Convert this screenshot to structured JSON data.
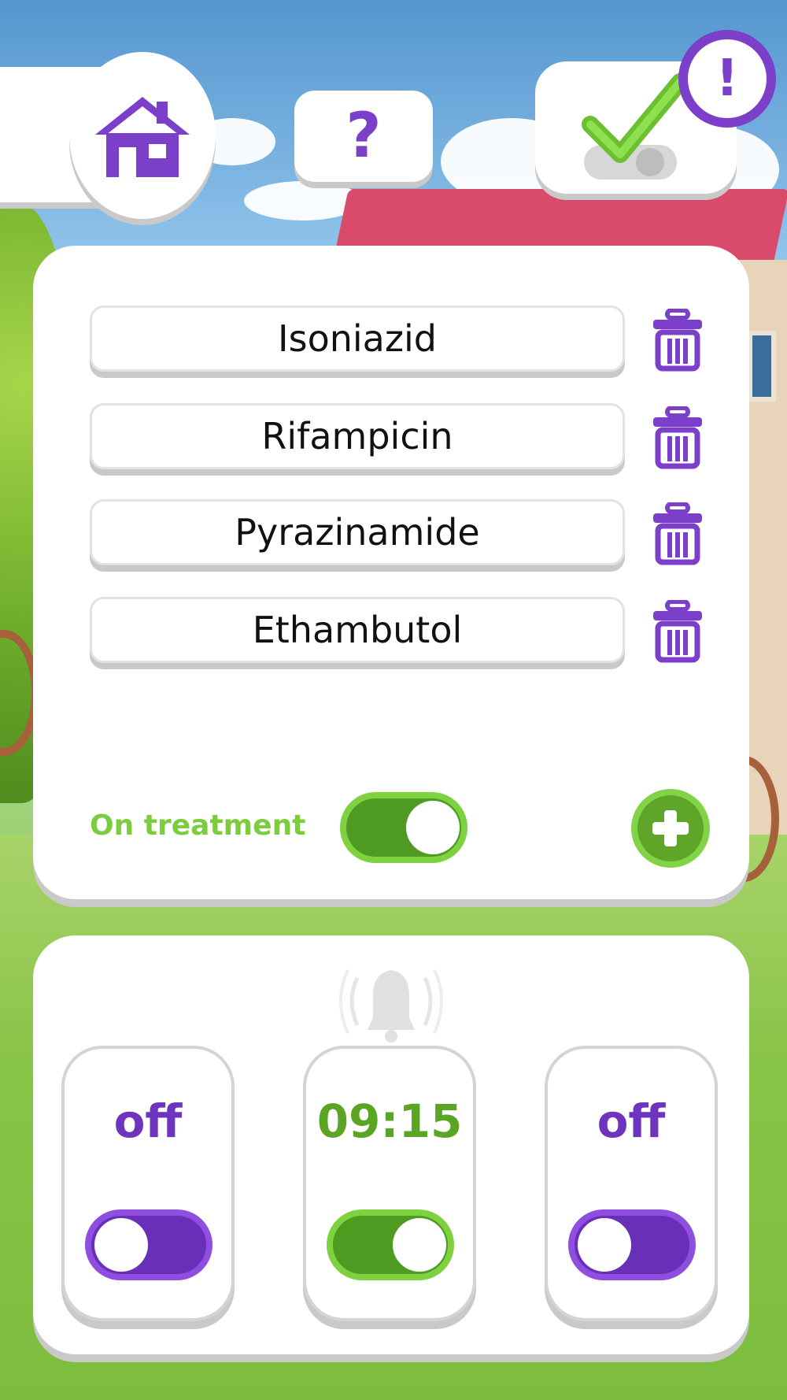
{
  "header": {
    "home_icon": "home-icon",
    "help_label": "?",
    "check_icon": "checkmark-toggle-icon",
    "alert_label": "!"
  },
  "medications": [
    {
      "name": "Isoniazid"
    },
    {
      "name": "Rifampicin"
    },
    {
      "name": "Pyrazinamide"
    },
    {
      "name": "Ethambutol"
    }
  ],
  "treatment": {
    "label": "On treatment",
    "enabled": true
  },
  "alarms": [
    {
      "label": "off",
      "enabled": false,
      "color": "#6f34bf"
    },
    {
      "label": "09:15",
      "enabled": true,
      "color": "#5aa524"
    },
    {
      "label": "off",
      "enabled": false,
      "color": "#6f34bf"
    }
  ],
  "colors": {
    "accent_purple": "#7b3fc9",
    "accent_green": "#7ccd3d"
  }
}
